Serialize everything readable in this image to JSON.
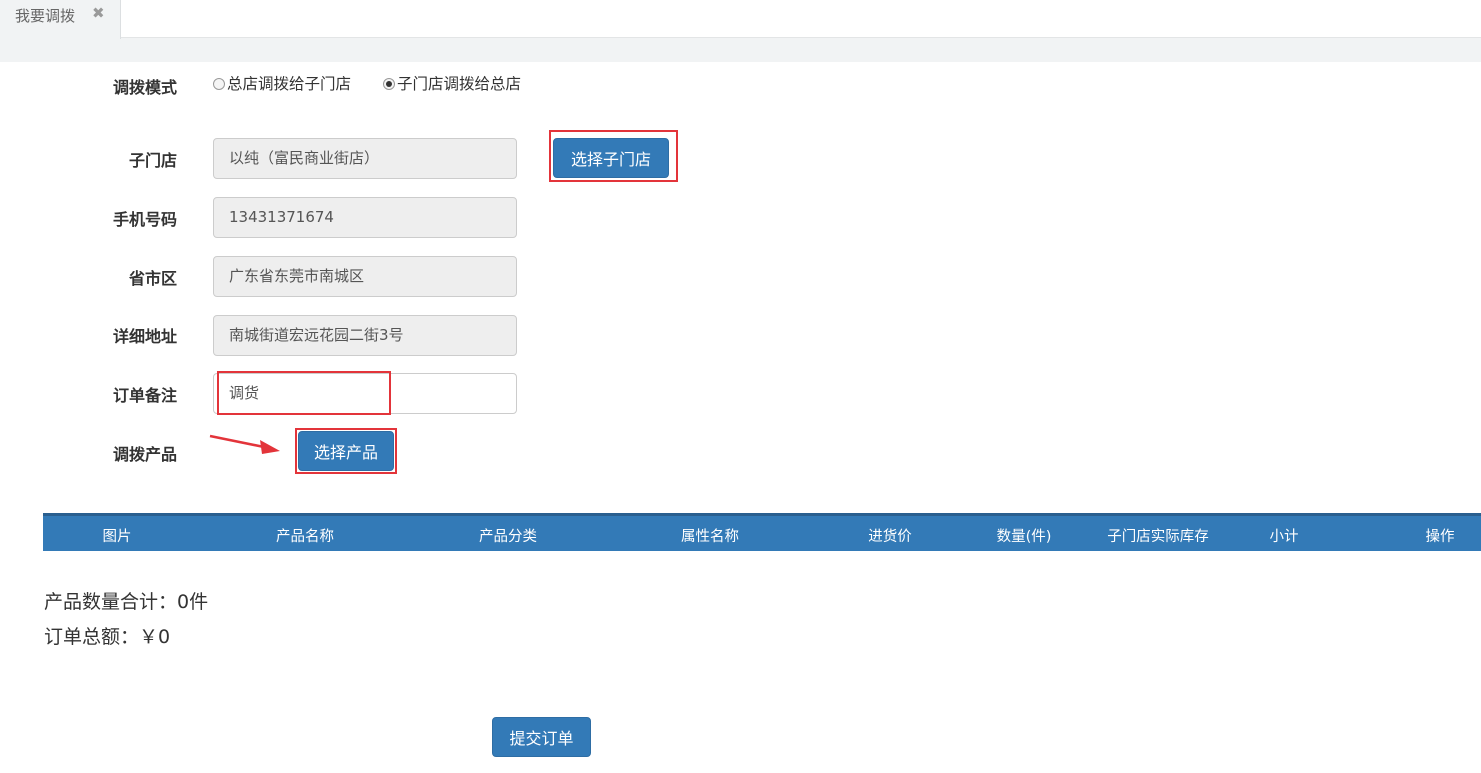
{
  "tab": {
    "title": "我要调拨",
    "close_glyph": "✖"
  },
  "form": {
    "mode_label": "调拨模式",
    "mode_options": [
      {
        "label": "总店调拨给子门店",
        "checked": false
      },
      {
        "label": "子门店调拨给总店",
        "checked": true
      }
    ],
    "store_label": "子门店",
    "store_value": "以纯（富民商业街店）",
    "select_store_button": "选择子门店",
    "phone_label": "手机号码",
    "phone_value": "13431371674",
    "region_label": "省市区",
    "region_value": "广东省东莞市南城区",
    "address_label": "详细地址",
    "address_value": "南城街道宏远花园二街3号",
    "note_label": "订单备注",
    "note_value": "调货",
    "products_label": "调拨产品",
    "select_product_button": "选择产品"
  },
  "table": {
    "headers": [
      "图片",
      "产品名称",
      "产品分类",
      "属性名称",
      "进货价",
      "数量(件)",
      "子门店实际库存",
      "小计",
      "操作"
    ],
    "header_color": "#337ab7"
  },
  "summary": {
    "quantity_text": "产品数量合计：0件",
    "total_text": "订单总额：￥0"
  },
  "submit_button": "提交订单",
  "colors": {
    "primary": "#337ab7",
    "highlight": "#e3343a"
  }
}
